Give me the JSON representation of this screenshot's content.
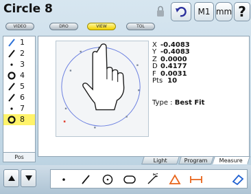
{
  "header": {
    "title": "Circle 8",
    "lock_icon": "lock-icon"
  },
  "toolbar": {
    "undo_icon": "undo-arrow-icon",
    "m1_label": "M1",
    "units_label": "mm",
    "help_label": "?"
  },
  "modes": [
    {
      "label": "VIDEO",
      "active": false
    },
    {
      "label": "DRO",
      "active": false
    },
    {
      "label": "VIEW",
      "active": true
    },
    {
      "label": "TOL",
      "active": false
    }
  ],
  "features": [
    {
      "icon": "line-icon",
      "num": "1",
      "selected": false
    },
    {
      "icon": "line-icon",
      "num": "2",
      "selected": false
    },
    {
      "icon": "point-icon",
      "num": "3",
      "selected": false
    },
    {
      "icon": "circle-icon",
      "num": "4",
      "selected": false
    },
    {
      "icon": "line-icon",
      "num": "5",
      "selected": false
    },
    {
      "icon": "line-icon",
      "num": "6",
      "selected": false
    },
    {
      "icon": "point-icon",
      "num": "7",
      "selected": false
    },
    {
      "icon": "circle-icon",
      "num": "8",
      "selected": true
    }
  ],
  "list_footer": "Pos",
  "readout": {
    "rows": [
      {
        "label": "X",
        "value": "-0.4083"
      },
      {
        "label": "Y",
        "value": "-0.4083"
      },
      {
        "label": "Z",
        "value": "0.0000"
      },
      {
        "label": "D",
        "value": "0.4177"
      },
      {
        "label": "F",
        "value": "0.0031"
      }
    ],
    "pts_label": "Pts",
    "pts_value": "10",
    "type_label": "Type :",
    "type_value": "Best Fit"
  },
  "tabs": [
    "Light",
    "Program",
    "Measure"
  ],
  "tools": [
    "point-tool-icon",
    "line-tool-icon",
    "circle-tool-icon",
    "slot-tool-icon",
    "distance-tool-icon",
    "angle-tool-icon",
    "width-tool-icon",
    "eraser-tool-icon"
  ],
  "colors": {
    "selected": "#fff36a",
    "active_mode": "#f2d200",
    "accent_orange": "#e8641a",
    "tool_blue": "#1e5fd0"
  }
}
